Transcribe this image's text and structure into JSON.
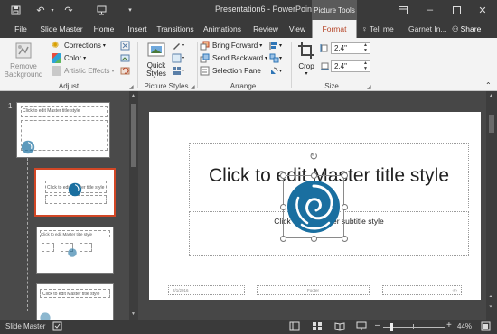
{
  "quick_access": {
    "save_icon": "save-icon",
    "undo_icon": "undo-icon",
    "redo_icon": "redo-icon",
    "present_icon": "present-icon",
    "customize_icon": "customize-icon"
  },
  "title_bar": {
    "document_title": "Presentation6 - PowerPoint",
    "context_group": "Picture Tools"
  },
  "tabs": [
    {
      "label": "File"
    },
    {
      "label": "Slide Master"
    },
    {
      "label": "Home"
    },
    {
      "label": "Insert"
    },
    {
      "label": "Transitions"
    },
    {
      "label": "Animations"
    },
    {
      "label": "Review"
    },
    {
      "label": "View"
    },
    {
      "label": "Format",
      "active": true
    }
  ],
  "tell_me": "Tell me",
  "user": "Garnet In...",
  "share": "Share",
  "ribbon": {
    "adjust": {
      "label": "Adjust",
      "remove_background": [
        "Remove",
        "Background"
      ],
      "corrections": "Corrections",
      "color": "Color",
      "artistic_effects": "Artistic Effects"
    },
    "picture_styles": {
      "label": "Picture Styles",
      "quick_styles": [
        "Quick",
        "Styles"
      ]
    },
    "arrange": {
      "label": "Arrange",
      "bring_forward": "Bring Forward",
      "send_backward": "Send Backward",
      "selection_pane": "Selection Pane"
    },
    "size": {
      "label": "Size",
      "crop": "Crop",
      "height": "2.4\"",
      "width": "2.4\""
    }
  },
  "thumbnails": {
    "slide_number": "1",
    "master_title": "Click to edit Master title style",
    "layout1_title": "Click to edit Master title style",
    "layout2_title": "Click to edit Master title style",
    "layout3_title": "Click to edit Master title style"
  },
  "slide": {
    "title": "Click to edit Master title style",
    "subtitle": "Click to edit Master subtitle style",
    "date": "2/1/2016",
    "footer": "Footer",
    "page": "‹#›"
  },
  "status": {
    "view": "Slide Master",
    "zoom": "44%"
  },
  "colors": {
    "accent": "#b7472a",
    "selection_border": "#d24726",
    "logo_blue": "#1a6fa0"
  }
}
